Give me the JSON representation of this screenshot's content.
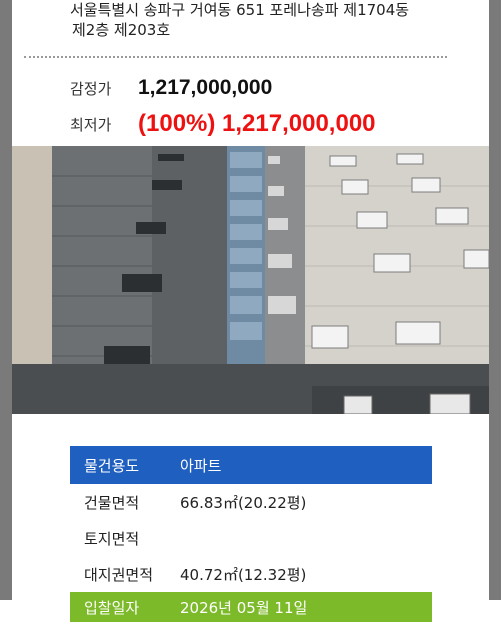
{
  "property": {
    "address_line1": "서울특별시 송파구 거여동 651 포레나송파 제1704동",
    "address_line2": "제2층 제203호"
  },
  "prices": {
    "appraisal_label": "감정가",
    "appraisal_value": "1,217,000,000",
    "minimum_label": "최저가",
    "minimum_value": "(100%) 1,217,000,000"
  },
  "details": {
    "usage_label": "물건용도",
    "usage_value": "아파트",
    "building_area_label": "건물면적",
    "building_area_value": "66.83㎡(20.22평)",
    "land_area_label": "토지면적",
    "land_area_value": "",
    "land_right_area_label": "대지권면적",
    "land_right_area_value": "40.72㎡(12.32평)",
    "auction_date_label": "입찰일자",
    "auction_date_value": "2026년 05월 11일"
  },
  "colors": {
    "minimum_price": "#ee1111",
    "usage_row_bg": "#1f5fbf",
    "date_row_bg": "#7cba2a"
  }
}
